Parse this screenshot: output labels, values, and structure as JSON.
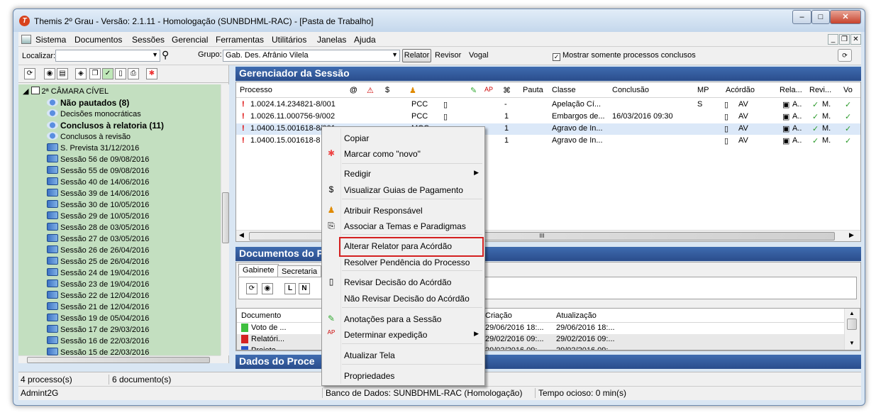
{
  "window": {
    "title": "Themis 2º Grau - Versão: 2.1.11 - Homologação (SUNBDHML-RAC) - [Pasta de Trabalho]",
    "app_icon": "T"
  },
  "menu": [
    "Sistema",
    "Documentos",
    "Sessões",
    "Gerencial",
    "Ferramentas",
    "Utilitários",
    "Janelas",
    "Ajuda"
  ],
  "toolbar": {
    "localizar_label": "Localizar:",
    "grupo_label": "Grupo:",
    "grupo_value": "Gab. Des. Afrânio Vilela",
    "btn_relator": "Relator",
    "btn_revisor": "Revisor",
    "btn_vogal": "Vogal",
    "chk_mostrar": "Mostrar somente processos conclusos"
  },
  "tree": {
    "root": "2ª CÂMARA CÍVEL",
    "items": [
      {
        "label": "Não pautados (8)",
        "bold": true
      },
      {
        "label": "Decisões monocráticas",
        "bold": false
      },
      {
        "label": "Conclusos à relatoria (11)",
        "bold": true
      },
      {
        "label": "Conclusos à revisão",
        "bold": false
      },
      {
        "label": "S. Prevista 31/12/2016",
        "bold": false
      },
      {
        "label": "Sessão 56 de 09/08/2016",
        "bold": false
      },
      {
        "label": "Sessão 55 de 09/08/2016",
        "bold": false
      },
      {
        "label": "Sessão 40 de 14/06/2016",
        "bold": false
      },
      {
        "label": "Sessão 39 de 14/06/2016",
        "bold": false
      },
      {
        "label": "Sessão 30 de 10/05/2016",
        "bold": false
      },
      {
        "label": "Sessão 29 de 10/05/2016",
        "bold": false
      },
      {
        "label": "Sessão 28 de 03/05/2016",
        "bold": false
      },
      {
        "label": "Sessão 27 de 03/05/2016",
        "bold": false
      },
      {
        "label": "Sessão 26 de 26/04/2016",
        "bold": false
      },
      {
        "label": "Sessão 25 de 26/04/2016",
        "bold": false
      },
      {
        "label": "Sessão 24 de 19/04/2016",
        "bold": false
      },
      {
        "label": "Sessão 23 de 19/04/2016",
        "bold": false
      },
      {
        "label": "Sessão 22 de 12/04/2016",
        "bold": false
      },
      {
        "label": "Sessão 21 de 12/04/2016",
        "bold": false
      },
      {
        "label": "Sessão 19 de 05/04/2016",
        "bold": false
      },
      {
        "label": "Sessão 17 de 29/03/2016",
        "bold": false
      },
      {
        "label": "Sessão 16 de 22/03/2016",
        "bold": false
      },
      {
        "label": "Sessão 15 de 22/03/2016",
        "bold": false
      }
    ]
  },
  "gerenciador": {
    "title": "Gerenciador da Sessão",
    "columns": [
      "Processo",
      "Pauta",
      "Classe",
      "Conclusão",
      "MP",
      "Acórdão",
      "Rela...",
      "Revi...",
      "Vo"
    ],
    "rows": [
      {
        "processo": "1.0024.14.234821-8/001",
        "tipo": "PCC",
        "n": "-",
        "classe": "Apelação Cí...",
        "conclusao": "",
        "mp": "S",
        "acordao": "AV",
        "rela": "A..",
        "revi": "M."
      },
      {
        "processo": "1.0026.11.000756-9/002",
        "tipo": "PCC",
        "n": "1",
        "classe": "Embargos de...",
        "conclusao": "16/03/2016 09:30",
        "mp": "",
        "acordao": "AV",
        "rela": "A..",
        "revi": "M."
      },
      {
        "processo": "1.0400.15.001618-8/001",
        "tipo": "MCC",
        "n": "1",
        "classe": "Agravo de In...",
        "conclusao": "",
        "mp": "",
        "acordao": "AV",
        "rela": "A..",
        "revi": "M."
      },
      {
        "processo": "1.0400.15.001618-8",
        "tipo": "",
        "n": "1",
        "classe": "Agravo de In...",
        "conclusao": "",
        "mp": "",
        "acordao": "AV",
        "rela": "A..",
        "revi": "M."
      }
    ]
  },
  "documentos": {
    "title": "Documentos do P",
    "tabs": [
      "Gabinete",
      "Secretaria"
    ],
    "letters": [
      "L",
      "N"
    ],
    "columns": [
      "Documento",
      "Criação",
      "Atualização"
    ],
    "rows": [
      {
        "doc": "Voto de ...",
        "criacao": "29/06/2016 18:...",
        "atualizacao": "29/06/2016 18:..."
      },
      {
        "doc": "Relatóri...",
        "criacao": "29/02/2016 09:...",
        "atualizacao": "29/02/2016 09:..."
      },
      {
        "doc": "Projeto ...",
        "criacao": "29/02/2016 09:...",
        "atualizacao": "29/02/2016 09:..."
      }
    ]
  },
  "dados": {
    "title": "Dados do Proce"
  },
  "context_menu": [
    {
      "label": "Copiar",
      "icon": ""
    },
    {
      "label": "Marcar como \"novo\"",
      "icon": "star-icon"
    },
    {
      "label": "Redigir",
      "icon": "",
      "submenu": true
    },
    {
      "label": "Visualizar Guias de Pagamento",
      "icon": "dollar-icon"
    },
    {
      "label": "Atribuir Responsável",
      "icon": "person-icon"
    },
    {
      "label": "Associar a Temas e Paradigmas",
      "icon": "link-icon"
    },
    {
      "label": "Alterar Relator para Acórdão",
      "icon": ""
    },
    {
      "label": "Resolver Pendência do Processo",
      "icon": ""
    },
    {
      "label": "Revisar Decisão do Acórdão",
      "icon": "doc-icon"
    },
    {
      "label": "Não Revisar Decisão do Acórdão",
      "icon": ""
    },
    {
      "label": "Anotações para a Sessão",
      "icon": "note-icon"
    },
    {
      "label": "Determinar expedição",
      "icon": "ap-icon",
      "submenu": true
    },
    {
      "label": "Atualizar Tela",
      "icon": ""
    },
    {
      "label": "Propriedades",
      "icon": ""
    }
  ],
  "status": {
    "processos": "4 processo(s)",
    "documentos": "6 documento(s)",
    "user": "Admint2G",
    "banco": "Banco de Dados: SUNBDHML-RAC (Homologação)",
    "ocioso": "Tempo ocioso: 0 min(s)"
  }
}
